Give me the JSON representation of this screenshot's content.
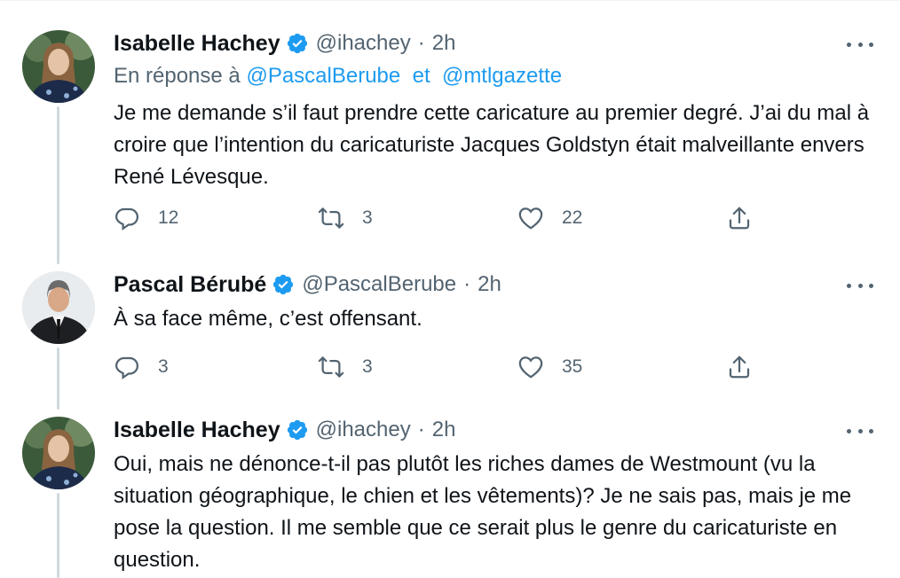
{
  "tweets": [
    {
      "author_name": "Isabelle Hachey",
      "handle": "@ihachey",
      "separator": "·",
      "time": "2h",
      "reply_prefix": "En réponse à",
      "reply_mention_1": "@PascalBerube",
      "reply_conjunction": "et",
      "reply_mention_2": "@mtlgazette",
      "text": "Je me demande s’il faut prendre cette caricature au premier degré. J’ai du mal à croire que l’intention du caricaturiste Jacques Goldstyn était malveillante envers René Lévesque.",
      "replies": "12",
      "retweets": "3",
      "likes": "22"
    },
    {
      "author_name": "Pascal Bérubé",
      "handle": "@PascalBerube",
      "separator": "·",
      "time": "2h",
      "text": "À sa face même, c’est offensant.",
      "replies": "3",
      "retweets": "3",
      "likes": "35"
    },
    {
      "author_name": "Isabelle Hachey",
      "handle": "@ihachey",
      "separator": "·",
      "time": "2h",
      "text": "Oui, mais ne dénonce-t-il pas plutôt les riches dames de Westmount (vu la situation géographique, le chien et les vêtements)? Je ne sais pas, mais je me pose la question. Il me semble que ce serait plus le genre du caricaturiste en question."
    }
  ],
  "icons": {
    "verified": "verified-badge-icon",
    "reply": "reply-icon",
    "retweet": "retweet-icon",
    "like": "heart-icon",
    "share": "share-icon",
    "more": "more-options-icon"
  },
  "colors": {
    "text": "#0f1419",
    "secondary": "#536471",
    "link": "#1d9bf0",
    "thread_line": "#cfd9de"
  }
}
